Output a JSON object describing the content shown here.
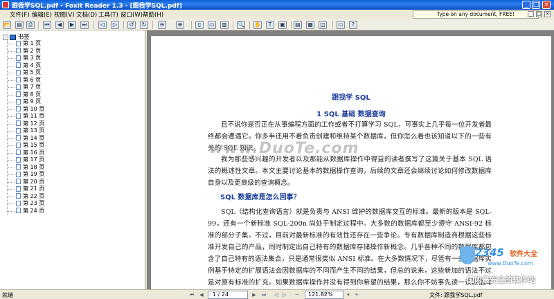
{
  "window": {
    "title": "跟我学SQL.pdf - Foxit Reader 1.3 - [跟我学SQL.pdf]",
    "min_glyph": "_",
    "max_glyph": "□",
    "close_glyph": "×"
  },
  "menu": {
    "items": [
      "文件(F)",
      "编辑(E)",
      "视图(V)",
      "文档(D)",
      "工具(T)",
      "窗口(W)",
      "帮助(H)"
    ],
    "ad_text": "Type on any document, FREE!",
    "mdi_min": "_",
    "mdi_restore": "□",
    "mdi_close": "×"
  },
  "toolbar": {
    "help_glyph": "?"
  },
  "sidebar": {
    "root_label": "书签",
    "expander": "-",
    "pages": [
      "第 1 页",
      "第 2 页",
      "第 3 页",
      "第 4 页",
      "第 5 页",
      "第 6 页",
      "第 7 页",
      "第 8 页",
      "第 9 页",
      "第 10 页",
      "第 11 页",
      "第 12 页",
      "第 13 页",
      "第 14 页",
      "第 15 页",
      "第 16 页",
      "第 17 页",
      "第 18 页",
      "第 19 页",
      "第 20 页",
      "第 21 页",
      "第 22 页",
      "第 23 页",
      "第 24 页"
    ]
  },
  "document": {
    "title": "跟我学 SQL",
    "subtitle": "1 SQL 基础  数据查询",
    "para1": "且不说你是否正在从事编程方面的工作或者不打算学习 SQL，可事实上几乎每一位开发者最终都会遭遇它。你多半还用不着负责创建和维持某个数据库，但你怎么着也该知道以下的一些有关的 SQL 知识。",
    "para2": "我为那些感兴趣的开发者以及那能从数据库操作中得益的读者撰写了这篇关于基本 SQL 语法的概述性文章。本文主要讨论基本的数据操作查询，后续的文章还会继续讨论如何修改数据库自身以及更高级的查询概念。",
    "heading2": "SQL 数据库是怎么回事？",
    "para3": "SQL（结构化查询语言）就是负责与 ANSI 维护的数据库交互的标准。最新的版本是 SQL-99，还有一个新标准 SQL-200n 尚处于制定过程中。大多数的数据库都至少遵守 ANSI-92 标准的部分子集。不过，目前对最新标准的有效性还存在一些争论。专有数据库制造商根据这些标准开发自己的产品，同时制定出自己特有的数据库存储操作新概念。几乎各种不同的数据库都包含了自己特有的语法集合，只是通常很类似 ANSI 标准。在大多数情况下，尽管有一些数据库实例基于特定的扩展语法会因数据库的不同而产生不同的结果，但总的说来，这些新加的语法不过是对原有标准的扩充。如果数据库操作并没有得到你希望的结果，那么你不妨事先读一读数据库制造商提供的产品说明。",
    "watermark": "www.DuoTe.com"
  },
  "ad_logo": {
    "num": "2345",
    "sw": "软件大全",
    "url": "www.DuoTe.com",
    "slogan": "国内最安全的软件站"
  },
  "status": {
    "left_text": "就绪",
    "page_field": "1 / 24",
    "zoom_field": "121.82%",
    "file_label": "文件: 跟我学SQL.pdf",
    "nav_first": "⏮",
    "nav_prev": "◀",
    "nav_next": "▶",
    "nav_last": "⏭",
    "nav_back": "◁",
    "nav_forward": "▷",
    "zoom_out": "－",
    "zoom_in": "＋",
    "dropdown": "▾"
  }
}
